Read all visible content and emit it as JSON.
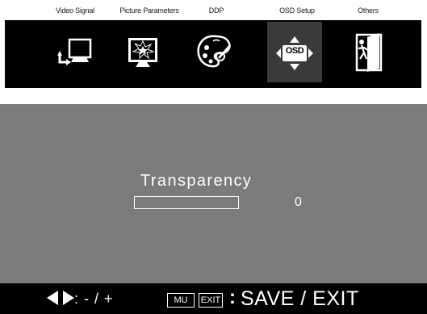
{
  "tabs": [
    {
      "label": "Video Signal",
      "icon": "monitor-input-icon",
      "selected": false
    },
    {
      "label": "Picture Parameters",
      "icon": "picture-burst-icon",
      "selected": false
    },
    {
      "label": "DDP",
      "icon": "palette-icon",
      "selected": false
    },
    {
      "label": "OSD Setup",
      "icon": "osd-dpad-icon",
      "selected": true
    },
    {
      "label": "Others",
      "icon": "door-exit-icon",
      "selected": false
    }
  ],
  "osd_icon_text": "OSD",
  "parameter": {
    "title": "Transparency",
    "value": "0",
    "level": 0
  },
  "footer": {
    "adjust_text": ": - / +",
    "menu_key": "MU",
    "exit_key": "EXIT",
    "colon": ":",
    "save_exit_text": "SAVE / EXIT"
  },
  "colors": {
    "panel_bg": "#7b7b7b",
    "bar_bg": "#000000",
    "selected_cell": "#3a3a3a"
  }
}
